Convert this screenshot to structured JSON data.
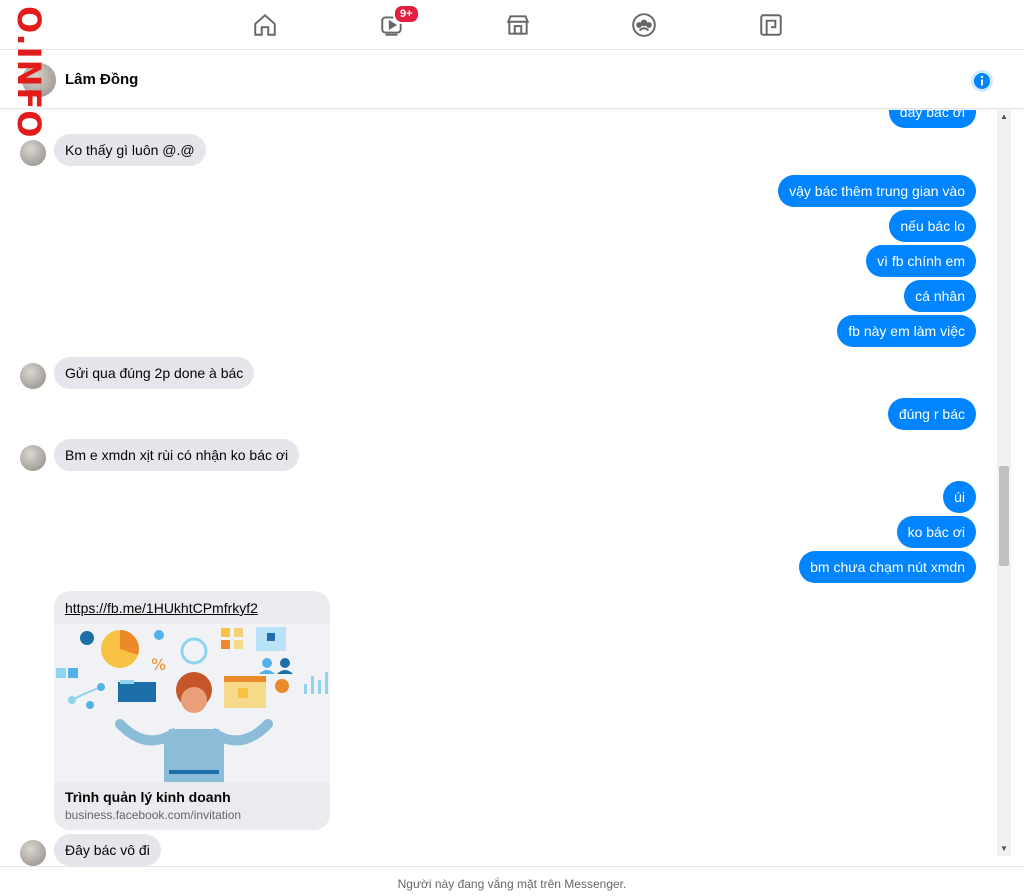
{
  "watermark": {
    "text": "O.INFO"
  },
  "nav": {
    "home_icon": "home-icon",
    "watch_icon": "watch-icon",
    "watch_badge": "9+",
    "marketplace_icon": "marketplace-icon",
    "groups_icon": "groups-icon",
    "gaming_icon": "gaming-icon"
  },
  "chat": {
    "contact_name": "Lâm Đồng",
    "info_icon": "info-icon"
  },
  "messages": [
    {
      "id": "m0",
      "side": "out",
      "text": "đây bác ơi"
    },
    {
      "id": "m1",
      "side": "in",
      "text": "Ko thấy gì luôn @.@"
    },
    {
      "id": "m2",
      "side": "out",
      "text": "vậy bác thêm trung gian vào"
    },
    {
      "id": "m3",
      "side": "out",
      "text": "nếu bác lo"
    },
    {
      "id": "m4",
      "side": "out",
      "text": "vì fb chính em"
    },
    {
      "id": "m5",
      "side": "out",
      "text": "cá nhân"
    },
    {
      "id": "m6",
      "side": "out",
      "text": "fb này em làm việc"
    },
    {
      "id": "m7",
      "side": "in",
      "text": "Gửi qua đúng 2p done à bác"
    },
    {
      "id": "m8",
      "side": "out",
      "text": "đúng r bác"
    },
    {
      "id": "m9",
      "side": "in",
      "text": "Bm e xmdn xịt rùi có nhận ko bác ơi"
    },
    {
      "id": "m10",
      "side": "out",
      "text": "úi"
    },
    {
      "id": "m11",
      "side": "out",
      "text": "ko bác ơi"
    },
    {
      "id": "m12",
      "side": "out",
      "text": "bm chưa chạm nút xmdn"
    },
    {
      "id": "m13",
      "side": "in",
      "text": "Đây bác vô đi"
    }
  ],
  "link_card": {
    "url": "https://fb.me/1HUkhtCPmfrkyf2",
    "title": "Trình quản lý kinh doanh",
    "domain": "business.facebook.com/invitation"
  },
  "footer": {
    "status_text": "Người này đang vắng mặt trên Messenger."
  },
  "colors": {
    "accent": "#0084ff",
    "incoming": "#e4e6eb",
    "badge": "#e41e3f",
    "watermark": "#e21b1b"
  }
}
